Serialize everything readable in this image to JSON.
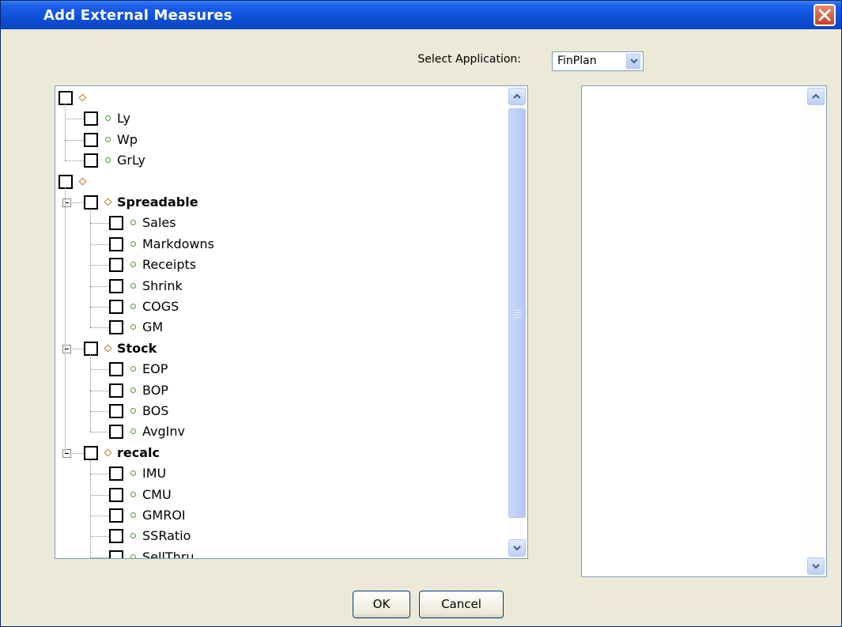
{
  "window": {
    "title": "Add External Measures"
  },
  "application": {
    "label": "Select Application:",
    "selected": "FinPlan"
  },
  "tree": {
    "rows": [
      {
        "label": "",
        "kind": "group",
        "level": 0
      },
      {
        "label": "Ly",
        "kind": "measure",
        "level": 1
      },
      {
        "label": "Wp",
        "kind": "measure",
        "level": 1
      },
      {
        "label": "GrLy",
        "kind": "measure",
        "level": 1
      },
      {
        "label": "",
        "kind": "group",
        "level": 0
      },
      {
        "label": "Spreadable",
        "kind": "group",
        "level": 1,
        "expanded": true
      },
      {
        "label": "Sales",
        "kind": "measure",
        "level": 2
      },
      {
        "label": "Markdowns",
        "kind": "measure",
        "level": 2
      },
      {
        "label": "Receipts",
        "kind": "measure",
        "level": 2
      },
      {
        "label": "Shrink",
        "kind": "measure",
        "level": 2
      },
      {
        "label": "COGS",
        "kind": "measure",
        "level": 2
      },
      {
        "label": "GM",
        "kind": "measure",
        "level": 2
      },
      {
        "label": "Stock",
        "kind": "group",
        "level": 1,
        "expanded": true
      },
      {
        "label": "EOP",
        "kind": "measure",
        "level": 2
      },
      {
        "label": "BOP",
        "kind": "measure",
        "level": 2
      },
      {
        "label": "BOS",
        "kind": "measure",
        "level": 2
      },
      {
        "label": "AvgInv",
        "kind": "measure",
        "level": 2
      },
      {
        "label": "recalc",
        "kind": "group",
        "level": 1,
        "expanded": true
      },
      {
        "label": "IMU",
        "kind": "measure",
        "level": 2
      },
      {
        "label": "CMU",
        "kind": "measure",
        "level": 2
      },
      {
        "label": "GMROI",
        "kind": "measure",
        "level": 2
      },
      {
        "label": "SSRatio",
        "kind": "measure",
        "level": 2
      },
      {
        "label": "SellThru",
        "kind": "measure",
        "level": 2
      }
    ]
  },
  "buttons": {
    "ok": "OK",
    "cancel": "Cancel"
  },
  "colors": {
    "title_bar": "#0f4fd6",
    "dialog_bg": "#ece9d8",
    "group_icon": "#c07a2a",
    "measure_icon": "#4a9a2a"
  },
  "icons": {
    "close": "close-icon",
    "dropdown": "chevron-down-icon",
    "group": "diamond-icon",
    "measure": "circle-icon"
  }
}
